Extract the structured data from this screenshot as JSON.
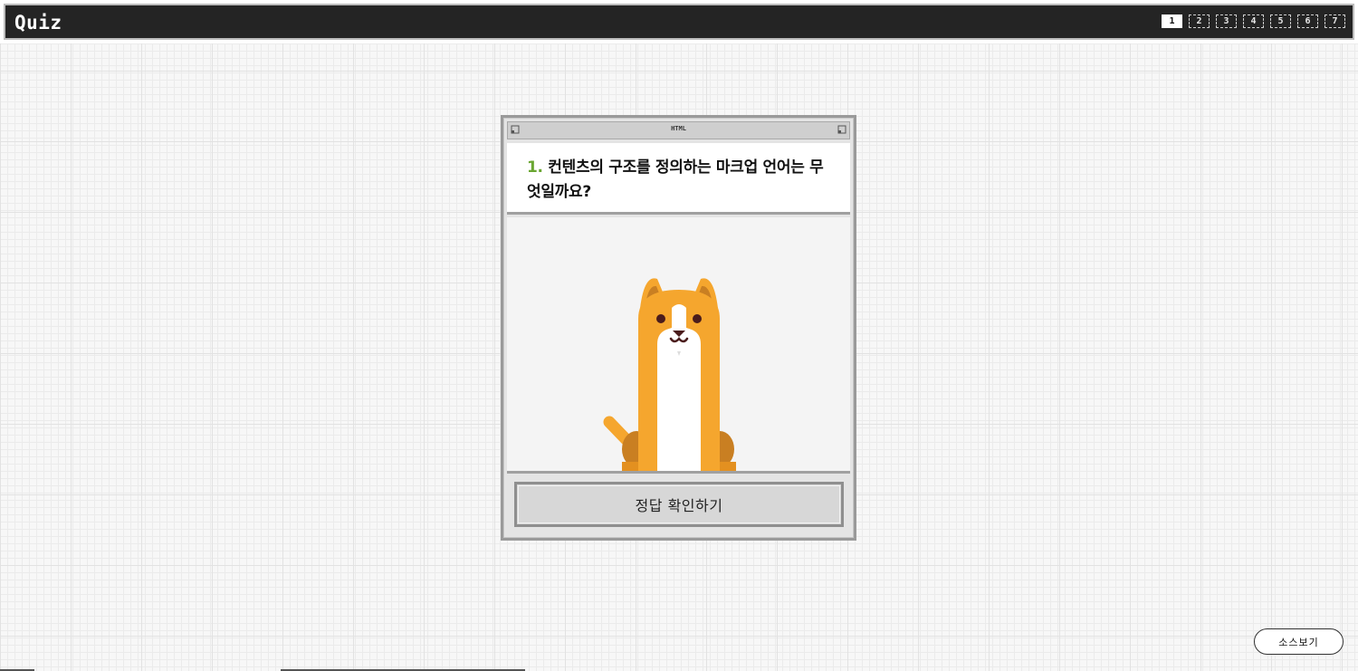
{
  "header": {
    "title": "Quiz",
    "pages": [
      "1",
      "2",
      "3",
      "4",
      "5",
      "6",
      "7"
    ],
    "active_page": "1"
  },
  "card": {
    "label": "HTML",
    "question_number": "1.",
    "question_text": " 컨텐츠의 구조를 정의하는 마크업 언어는 무엇일까요?",
    "image": "dog-illustration",
    "check_button": "정답 확인하기"
  },
  "footer": {
    "source_button": "소스보기"
  },
  "colors": {
    "accent_green": "#6aa632",
    "dog_orange": "#f5a62e",
    "topbar": "#242424"
  }
}
